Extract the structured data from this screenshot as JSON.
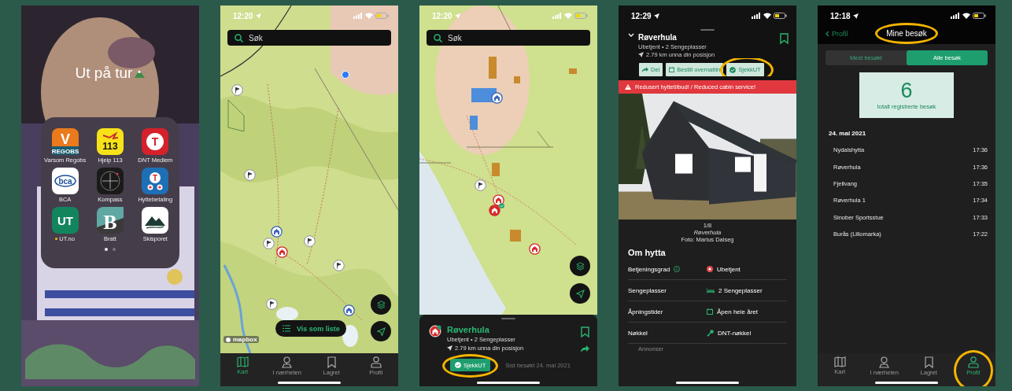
{
  "screens": [
    {
      "kind": "home",
      "folder_title": "Ut på tur",
      "apps": [
        {
          "kind": "varsom",
          "label": "Varsom Regobs",
          "texts": [
            "V",
            "REGOBS"
          ],
          "new": false
        },
        {
          "kind": "help113",
          "label": "Hjelp 113",
          "texts": [
            "113"
          ],
          "new": false
        },
        {
          "kind": "dnt",
          "label": "DNT Medlem",
          "texts": [
            "T"
          ],
          "new": false
        },
        {
          "kind": "bca",
          "label": "BCA",
          "texts": [
            "bca"
          ],
          "new": false
        },
        {
          "kind": "compass",
          "label": "Kompass",
          "new": false
        },
        {
          "kind": "cabinpay",
          "label": "Hyttebetaling",
          "texts": [
            "T"
          ],
          "new": false
        },
        {
          "kind": "ut",
          "label": "UT.no",
          "texts": [
            "UT"
          ],
          "new": true
        },
        {
          "kind": "bratt",
          "label": "Bratt",
          "texts": [
            "B"
          ],
          "new": false
        },
        {
          "kind": "ski",
          "label": "Skisporet",
          "new": false
        }
      ],
      "page_dots": [
        {
          "selected": true
        },
        {
          "selected": false
        }
      ]
    },
    {
      "kind": "map",
      "status_time": "12:20",
      "search": {
        "placeholder": "Søk"
      },
      "list_button": "Vis som liste",
      "attribution": "mapbox",
      "tabs": [
        {
          "label": "Kart",
          "selected": true,
          "highlighted": false
        },
        {
          "label": "I nærheten",
          "selected": false,
          "highlighted": false
        },
        {
          "label": "Lagret",
          "selected": false,
          "highlighted": false
        },
        {
          "label": "Profil",
          "selected": false,
          "highlighted": false
        }
      ]
    },
    {
      "kind": "map_detail",
      "status_time": "12:20",
      "search": {
        "placeholder": "Søk"
      },
      "sheet": {
        "title": "Røverhula",
        "subtitle": "Ubetjent • 2 Sengeplasser",
        "distance": "2.79 km unna din posisjon",
        "checkin_button": {
          "label": "SjekkUT",
          "highlighted": true
        },
        "last_visit": "Sist besøkt 24. mai 2021"
      }
    },
    {
      "kind": "cabin",
      "status_time": "12:29",
      "title": "Røverhula",
      "subtitle": "Ubetjent • 2 Sengeplasser",
      "distance": "2.79 km unna din posisjon",
      "actions": [
        {
          "kind": "share",
          "label": "Del",
          "highlighted": false
        },
        {
          "kind": "book",
          "label": "Bestill overnattin",
          "highlighted": false
        },
        {
          "kind": "checkin",
          "label": "SjekkUT",
          "highlighted": true
        }
      ],
      "alert": "Redusert hyttetilbud! / Reduced cabin service!",
      "photo": {
        "counter": "1/8",
        "caption": "Røverhula",
        "credit": "Foto: Marius Dalseg"
      },
      "section_title": "Om hytta",
      "facts": [
        {
          "kind": "service",
          "label": "Betjeningsgrad",
          "value": "Ubetjent",
          "info": true
        },
        {
          "kind": "beds",
          "label": "Sengeplasser",
          "value": "2 Sengeplasser",
          "info": false
        },
        {
          "kind": "opening",
          "label": "Åpningstider",
          "value": "Åpen hele året",
          "info": false
        },
        {
          "kind": "key",
          "label": "Nøkkel",
          "value": "DNT-nøkkel",
          "info": false
        }
      ],
      "footer": "Annonser"
    },
    {
      "kind": "visits",
      "status_time": "12:18",
      "back": "Profil",
      "title": {
        "text": "Mine besøk",
        "highlighted": true
      },
      "segments": [
        {
          "label": "Mest besøkt",
          "selected": false
        },
        {
          "label": "Alle besøk",
          "selected": true
        }
      ],
      "total": "6",
      "total_label": "totalt registrerte besøk",
      "date": "24. mai 2021",
      "visits": [
        {
          "name": "Nydalshytta",
          "time": "17:36"
        },
        {
          "name": "Røverhula",
          "time": "17:36"
        },
        {
          "name": "Fjellvang",
          "time": "17:35"
        },
        {
          "name": "Røverhula 1",
          "time": "17:34"
        },
        {
          "name": "Sinober Sportsstue",
          "time": "17:33"
        },
        {
          "name": "Burås (Lillomarka)",
          "time": "17:22"
        }
      ],
      "tabs": [
        {
          "label": "Kart",
          "selected": false,
          "highlighted": false
        },
        {
          "label": "I nærheten",
          "selected": false,
          "highlighted": false
        },
        {
          "label": "Lagret",
          "selected": false,
          "highlighted": false
        },
        {
          "label": "Profil",
          "selected": true,
          "highlighted": true
        }
      ]
    }
  ]
}
